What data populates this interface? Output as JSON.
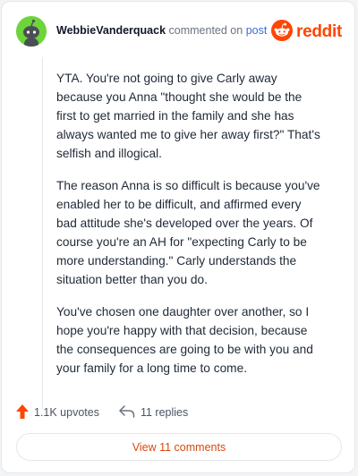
{
  "header": {
    "username": "WebbieVanderquack",
    "action_text": "commented on",
    "post_link": "post",
    "brand_name": "reddit"
  },
  "comment": {
    "paragraphs": [
      "YTA. You're not going to give Carly away because you Anna \"thought she would be the first to get married in the family and she has always wanted me to give her away first?\" That's selfish and illogical.",
      "The reason Anna is so difficult is because you've enabled her to be difficult, and affirmed every bad attitude she's developed over the years. Of course you're an AH for \"expecting Carly to be more understanding.\" Carly understands the situation better than you do.",
      "You've chosen one daughter over another, so I hope you're happy with that decision, because the consequences are going to be with you and your family for a long time to come."
    ]
  },
  "actions": {
    "upvotes": "1.1K upvotes",
    "replies": "11 replies"
  },
  "view_comments_label": "View 11 comments",
  "colors": {
    "brand": "#ff4500",
    "avatar_bg": "#6dd43a",
    "link": "#3b6fd6",
    "view_button_text": "#d9480f"
  },
  "icons": {
    "avatar": "snoo-avatar-icon",
    "brand": "reddit-logo-icon",
    "upvote": "upvote-arrow-icon",
    "reply": "reply-arrow-icon"
  }
}
